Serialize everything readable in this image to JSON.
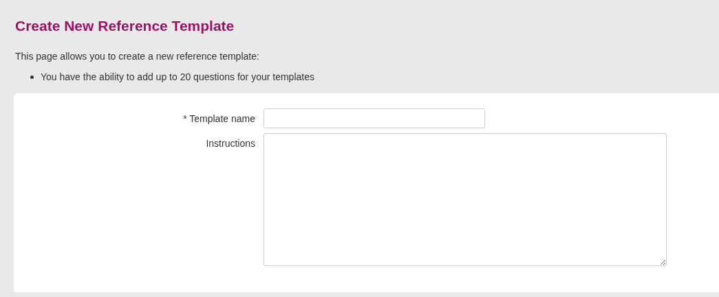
{
  "page": {
    "title": "Create New Reference Template",
    "intro": "This page allows you to create a new reference template:",
    "bullets": [
      "You have the ability to add up to 20 questions for your templates"
    ]
  },
  "form": {
    "fields": [
      {
        "kind": "text",
        "label": "* Template name"
      },
      {
        "kind": "textarea",
        "label": "Instructions"
      }
    ]
  }
}
